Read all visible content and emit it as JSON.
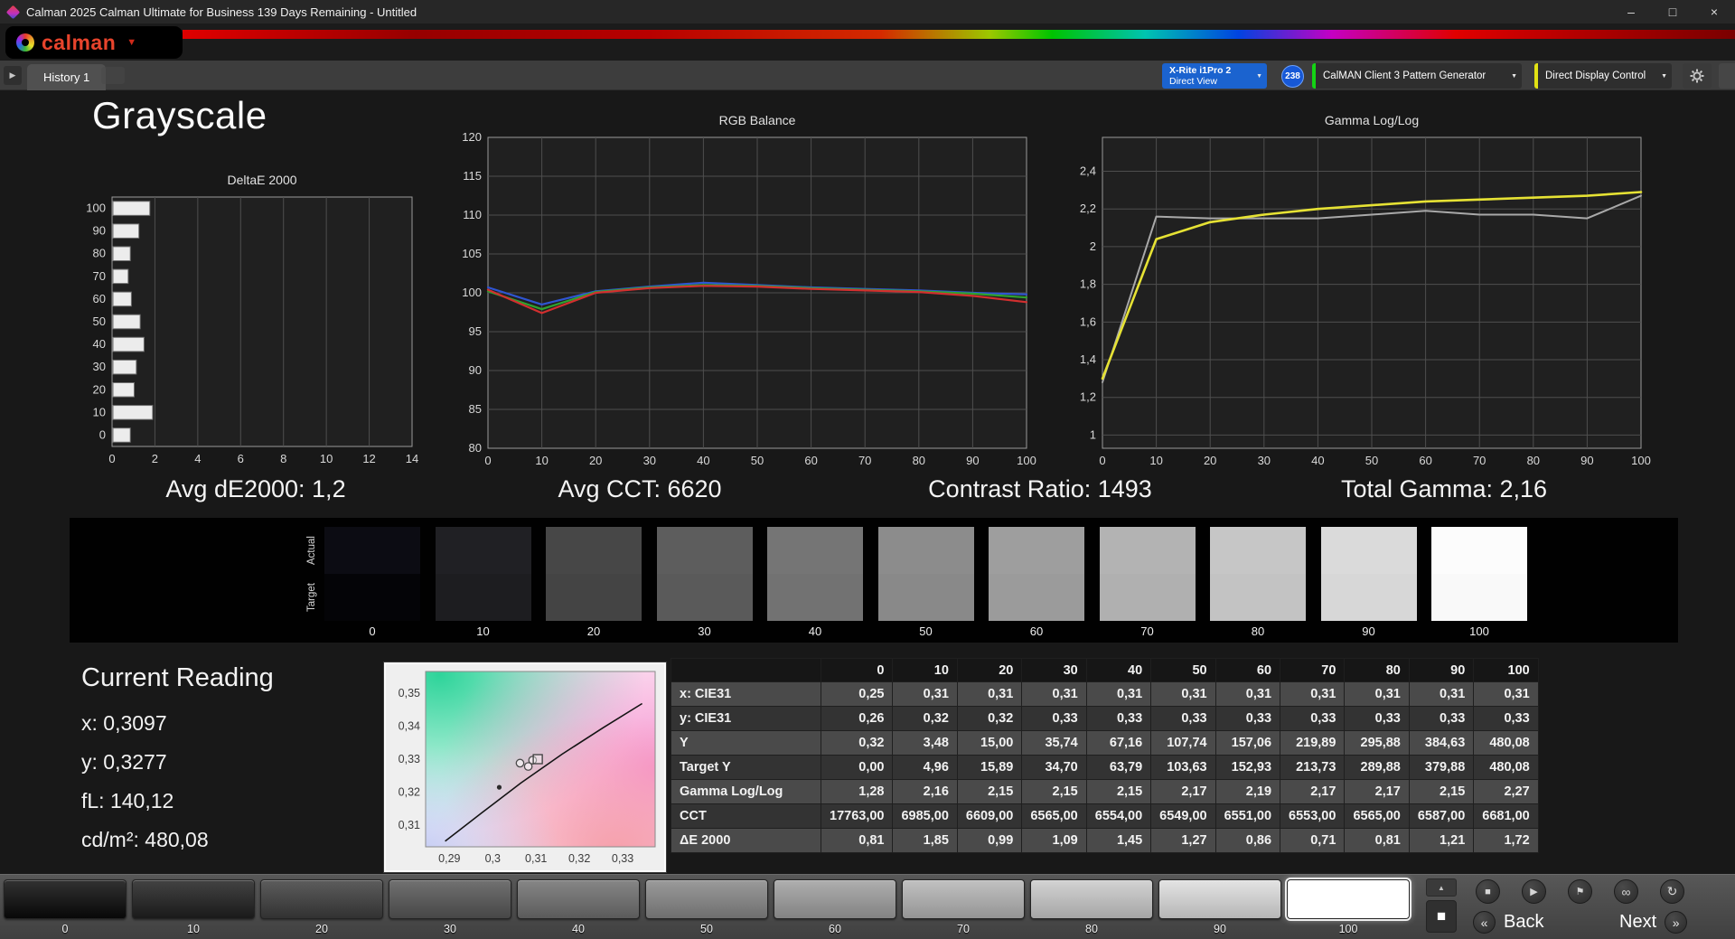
{
  "window": {
    "title": "Calman 2025 Calman Ultimate for Business 139 Days Remaining - Untitled",
    "minimize": "–",
    "maximize": "□",
    "close": "×"
  },
  "brand": {
    "logo_text": "calman",
    "dropdown_arrow": "▼"
  },
  "tabbar": {
    "nav_arrow": "▶",
    "history_tab": "History 1",
    "chevron": "▼",
    "meter_line1": "X-Rite i1Pro 2",
    "meter_line2": "Direct View",
    "meter_badge": "238",
    "pattern_generator": "CalMAN Client 3 Pattern Generator",
    "display_control": "Direct Display Control"
  },
  "page_title": "Grayscale",
  "stats": {
    "avg_de": "Avg dE2000: 1,2",
    "avg_cct": "Avg CCT: 6620",
    "contrast": "Contrast Ratio: 1493",
    "total_gamma": "Total Gamma: 2,16"
  },
  "swatch_strip": {
    "actual_label": "Actual",
    "target_label": "Target",
    "levels": [
      "0",
      "10",
      "20",
      "30",
      "40",
      "50",
      "60",
      "70",
      "80",
      "90",
      "100"
    ],
    "actual_colors": [
      "#0c0c13",
      "#202024",
      "#474747",
      "#5d5d5d",
      "#757575",
      "#8c8c8c",
      "#9e9e9e",
      "#b3b3b3",
      "#c6c6c6",
      "#dadada",
      "#fcfcfc"
    ],
    "target_colors": [
      "#040407",
      "#1d1d20",
      "#444444",
      "#5a5a5a",
      "#727272",
      "#898989",
      "#9b9b9b",
      "#b0b0b0",
      "#c3c3c3",
      "#d7d7d7",
      "#f9f9f9"
    ]
  },
  "current_reading": {
    "title": "Current Reading",
    "lines": [
      "x: 0,3097",
      "y: 0,3277",
      "fL: 140,12",
      "cd/m²: 480,08"
    ]
  },
  "table": {
    "columns": [
      "0",
      "10",
      "20",
      "30",
      "40",
      "50",
      "60",
      "70",
      "80",
      "90",
      "100"
    ],
    "rows": [
      {
        "label": "x: CIE31",
        "values": [
          "0,25",
          "0,31",
          "0,31",
          "0,31",
          "0,31",
          "0,31",
          "0,31",
          "0,31",
          "0,31",
          "0,31",
          "0,31"
        ]
      },
      {
        "label": "y: CIE31",
        "values": [
          "0,26",
          "0,32",
          "0,32",
          "0,33",
          "0,33",
          "0,33",
          "0,33",
          "0,33",
          "0,33",
          "0,33",
          "0,33"
        ]
      },
      {
        "label": "Y",
        "values": [
          "0,32",
          "3,48",
          "15,00",
          "35,74",
          "67,16",
          "107,74",
          "157,06",
          "219,89",
          "295,88",
          "384,63",
          "480,08"
        ]
      },
      {
        "label": "Target Y",
        "values": [
          "0,00",
          "4,96",
          "15,89",
          "34,70",
          "63,79",
          "103,63",
          "152,93",
          "213,73",
          "289,88",
          "379,88",
          "480,08"
        ]
      },
      {
        "label": "Gamma Log/Log",
        "values": [
          "1,28",
          "2,16",
          "2,15",
          "2,15",
          "2,15",
          "2,17",
          "2,19",
          "2,17",
          "2,17",
          "2,15",
          "2,27"
        ]
      },
      {
        "label": "CCT",
        "values": [
          "17763,00",
          "6985,00",
          "6609,00",
          "6565,00",
          "6554,00",
          "6549,00",
          "6551,00",
          "6553,00",
          "6565,00",
          "6587,00",
          "6681,00"
        ]
      },
      {
        "label": "ΔE 2000",
        "values": [
          "0,81",
          "1,85",
          "0,99",
          "1,09",
          "1,45",
          "1,27",
          "0,86",
          "0,71",
          "0,81",
          "1,21",
          "1,72"
        ]
      }
    ]
  },
  "bottombar": {
    "levels": [
      "0",
      "10",
      "20",
      "30",
      "40",
      "50",
      "60",
      "70",
      "80",
      "90",
      "100"
    ],
    "colors": [
      "#0a0a0a",
      "#1f1f1f",
      "#3d3d3d",
      "#565656",
      "#6f6f6f",
      "#878787",
      "#9f9f9f",
      "#b5b5b5",
      "#cacaca",
      "#dedede",
      "#ffffff"
    ],
    "selected_level": "100",
    "back_label": "Back",
    "next_label": "Next",
    "back_arrow": "«",
    "next_arrow": "»",
    "up_glyph": "▲",
    "pattern_window_glyph": "■",
    "stop_glyph": "■",
    "play_glyph": "▶",
    "flag_glyph": "⚑",
    "loop_glyph": "∞",
    "refresh_glyph": "↻"
  },
  "chart_data": [
    {
      "id": "deltae_2000",
      "type": "bar",
      "orientation": "horizontal",
      "title": "DeltaE 2000",
      "categories": [
        "0",
        "10",
        "20",
        "30",
        "40",
        "50",
        "60",
        "70",
        "80",
        "90",
        "100"
      ],
      "values": [
        0.81,
        1.85,
        0.99,
        1.09,
        1.45,
        1.27,
        0.86,
        0.71,
        0.81,
        1.21,
        1.72
      ],
      "xlim": [
        0,
        14
      ],
      "xticks": [
        0,
        2,
        4,
        6,
        8,
        10,
        12,
        14
      ],
      "bar_color": "#ececec"
    },
    {
      "id": "rgb_balance",
      "type": "line",
      "title": "RGB Balance",
      "x": [
        0,
        10,
        20,
        30,
        40,
        50,
        60,
        70,
        80,
        90,
        100
      ],
      "xlim": [
        0,
        100
      ],
      "ylim": [
        80,
        120
      ],
      "xticks": [
        {
          "v": 0,
          "label": "0"
        },
        {
          "v": 10,
          "label": "10"
        },
        {
          "v": 20,
          "label": "20"
        },
        {
          "v": 30,
          "label": "30"
        },
        {
          "v": 40,
          "label": "40"
        },
        {
          "v": 50,
          "label": "50"
        },
        {
          "v": 60,
          "label": "60"
        },
        {
          "v": 70,
          "label": "70"
        },
        {
          "v": 80,
          "label": "80"
        },
        {
          "v": 90,
          "label": "90"
        },
        {
          "v": 100,
          "label": "100"
        }
      ],
      "yticks": [
        {
          "v": 80,
          "label": "80"
        },
        {
          "v": 85,
          "label": "85"
        },
        {
          "v": 90,
          "label": "90"
        },
        {
          "v": 95,
          "label": "95"
        },
        {
          "v": 100,
          "label": "100"
        },
        {
          "v": 105,
          "label": "105"
        },
        {
          "v": 110,
          "label": "110"
        },
        {
          "v": 115,
          "label": "115"
        },
        {
          "v": 120,
          "label": "120"
        }
      ],
      "series": [
        {
          "name": "blue-line",
          "color": "#2f55d2",
          "width": 2.2,
          "values": [
            100.7,
            98.5,
            100.2,
            100.8,
            101.3,
            101.0,
            100.7,
            100.5,
            100.3,
            100.0,
            99.8
          ]
        },
        {
          "name": "green-line",
          "color": "#2fa32f",
          "width": 2.2,
          "values": [
            100.2,
            97.9,
            100.1,
            100.7,
            101.0,
            100.9,
            100.6,
            100.4,
            100.2,
            99.9,
            99.4
          ]
        },
        {
          "name": "red-line",
          "color": "#d22f2f",
          "width": 2.2,
          "values": [
            100.4,
            97.4,
            100.0,
            100.6,
            100.9,
            100.8,
            100.5,
            100.3,
            100.1,
            99.6,
            98.8
          ]
        }
      ]
    },
    {
      "id": "gamma_loglog",
      "type": "line",
      "title": "Gamma Log/Log",
      "x": [
        0,
        10,
        20,
        30,
        40,
        50,
        60,
        70,
        80,
        90,
        100
      ],
      "xlim": [
        0,
        100
      ],
      "ylim": [
        0.93,
        2.58
      ],
      "xticks": [
        {
          "v": 0,
          "label": "0"
        },
        {
          "v": 10,
          "label": "10"
        },
        {
          "v": 20,
          "label": "20"
        },
        {
          "v": 30,
          "label": "30"
        },
        {
          "v": 40,
          "label": "40"
        },
        {
          "v": 50,
          "label": "50"
        },
        {
          "v": 60,
          "label": "60"
        },
        {
          "v": 70,
          "label": "70"
        },
        {
          "v": 80,
          "label": "80"
        },
        {
          "v": 90,
          "label": "90"
        },
        {
          "v": 100,
          "label": "100"
        }
      ],
      "yticks": [
        {
          "v": 1,
          "label": "1"
        },
        {
          "v": 1.2,
          "label": "1,2"
        },
        {
          "v": 1.4,
          "label": "1,4"
        },
        {
          "v": 1.6,
          "label": "1,6"
        },
        {
          "v": 1.8,
          "label": "1,8"
        },
        {
          "v": 2,
          "label": "2"
        },
        {
          "v": 2.2,
          "label": "2,2"
        },
        {
          "v": 2.4,
          "label": "2,4"
        }
      ],
      "series": [
        {
          "name": "gray-line",
          "color": "#a9a9a9",
          "width": 2,
          "values": [
            1.28,
            2.16,
            2.15,
            2.15,
            2.15,
            2.17,
            2.19,
            2.17,
            2.17,
            2.15,
            2.27
          ]
        },
        {
          "name": "yellow-line",
          "color": "#e6e234",
          "width": 2.6,
          "values": [
            1.3,
            2.04,
            2.13,
            2.17,
            2.2,
            2.22,
            2.24,
            2.25,
            2.26,
            2.27,
            2.29
          ]
        }
      ]
    },
    {
      "id": "cie_scatter",
      "type": "scatter",
      "xlim": [
        0.2845,
        0.3375
      ],
      "ylim": [
        0.3035,
        0.3565
      ],
      "xticks": [
        {
          "v": 0.29,
          "label": "0,29"
        },
        {
          "v": 0.3,
          "label": "0,3"
        },
        {
          "v": 0.31,
          "label": "0,31"
        },
        {
          "v": 0.32,
          "label": "0,32"
        },
        {
          "v": 0.33,
          "label": "0,33"
        }
      ],
      "yticks": [
        {
          "v": 0.31,
          "label": "0,31"
        },
        {
          "v": 0.32,
          "label": "0,32"
        },
        {
          "v": 0.33,
          "label": "0,33"
        },
        {
          "v": 0.34,
          "label": "0,34"
        },
        {
          "v": 0.35,
          "label": "0,35"
        }
      ],
      "locus": [
        [
          0.289,
          0.3052
        ],
        [
          0.2975,
          0.3138
        ],
        [
          0.3065,
          0.3228
        ],
        [
          0.316,
          0.3315
        ],
        [
          0.3255,
          0.3395
        ],
        [
          0.3345,
          0.3468
        ]
      ],
      "points": [
        {
          "x": 0.3015,
          "y": 0.3215,
          "marker": "dot"
        },
        {
          "x": 0.3063,
          "y": 0.3288,
          "marker": "circle"
        },
        {
          "x": 0.3082,
          "y": 0.3278,
          "marker": "circle"
        },
        {
          "x": 0.3092,
          "y": 0.3297,
          "marker": "circle"
        },
        {
          "x": 0.3104,
          "y": 0.33,
          "marker": "square"
        }
      ]
    }
  ]
}
